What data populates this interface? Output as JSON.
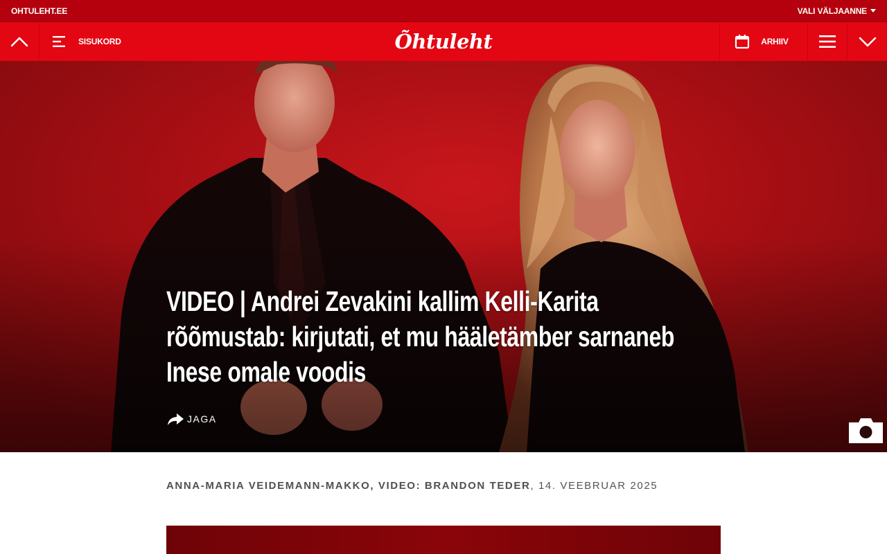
{
  "topbar": {
    "site_label": "OHTULEHT.EE",
    "edition_picker": "VALI VÄLJAANNE"
  },
  "navbar": {
    "toc_label": "SISUKORD",
    "logo_text": "Õhtuleht",
    "archive_label": "ARHIIV",
    "icons": [
      "chevron-up-icon",
      "toc-lines-icon",
      "calendar-icon",
      "hamburger-menu-icon",
      "chevron-down-icon"
    ]
  },
  "article": {
    "headline": "VIDEO | Andrei Zevakini kallim Kelli-Karita rõõmustab: kirjutati, et mu hääletämber sarnaneb Inese omale voodis",
    "share_label": "JAGA",
    "authors": "ANNA-MARIA VEIDEMANN-MAKKO, VIDEO: BRANDON TEDER",
    "date": ", 14. VEEBRUAR 2025"
  },
  "colors": {
    "brand_red": "#e30613",
    "topbar_red": "#b5000d",
    "hero_red": "#b3121a",
    "byline_gray": "#555555"
  }
}
